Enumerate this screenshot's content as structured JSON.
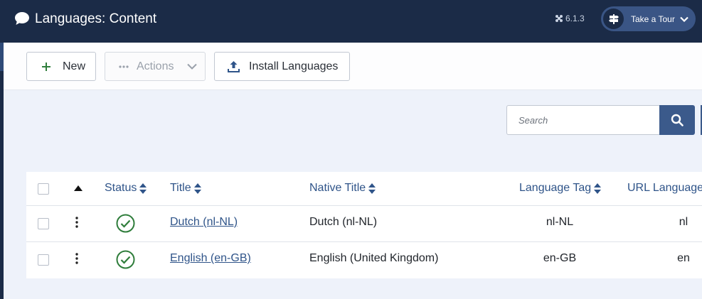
{
  "header": {
    "title": "Languages: Content",
    "version": "6.1.3",
    "tour_label": "Take a Tour",
    "icons": {
      "title": "chat-bubble-icon",
      "version": "joomla-icon",
      "tour": "signpost-icon",
      "tour_caret": "chevron-down-icon"
    }
  },
  "toolbar": {
    "new_label": "New",
    "actions_label": "Actions",
    "install_label": "Install Languages",
    "icons": {
      "new": "plus-icon",
      "actions": "ellipsis-icon",
      "actions_caret": "chevron-down-icon",
      "install": "upload-icon"
    }
  },
  "search": {
    "placeholder": "Search",
    "icon": "search-icon"
  },
  "table": {
    "columns": [
      "Status",
      "Title",
      "Native Title",
      "Language Tag",
      "URL Language"
    ],
    "rows": [
      {
        "status": "published",
        "title": "Dutch (nl-NL)",
        "native_title": "Dutch (nl-NL)",
        "language_tag": "nl-NL",
        "url_language": "nl"
      },
      {
        "status": "published",
        "title": "English (en-GB)",
        "native_title": "English (United Kingdom)",
        "language_tag": "en-GB",
        "url_language": "en"
      }
    ]
  },
  "colors": {
    "header_bg": "#1b2b47",
    "accent": "#2f5489",
    "published_green": "#2f7d3b",
    "page_bg": "#eef2fa"
  }
}
